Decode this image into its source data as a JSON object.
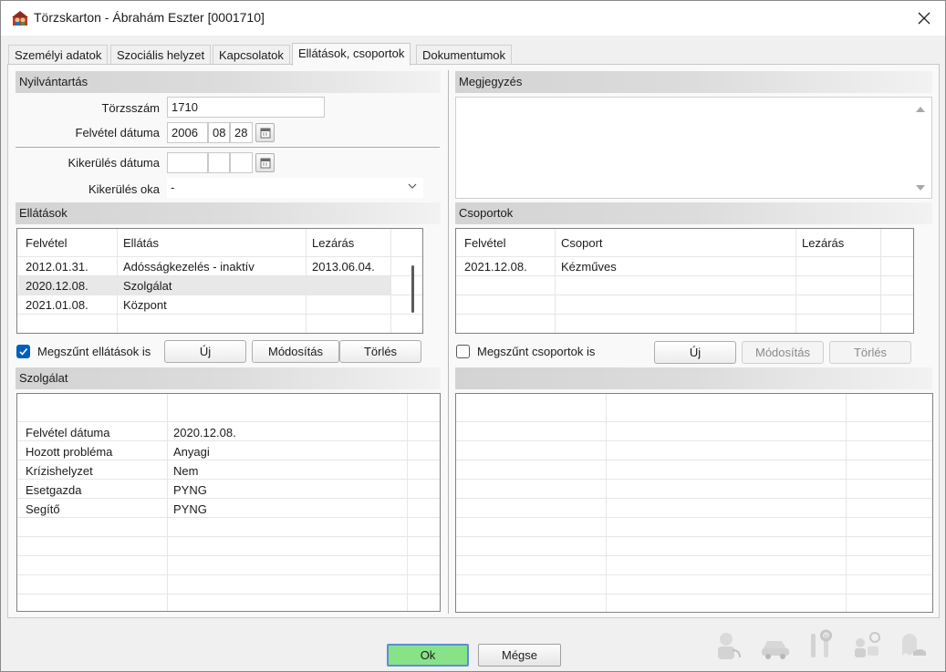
{
  "window": {
    "title": "Törzskarton - Ábrahám Eszter [0001710]"
  },
  "tabs": [
    {
      "label": "Személyi adatok"
    },
    {
      "label": "Szociális helyzet"
    },
    {
      "label": "Kapcsolatok"
    },
    {
      "label": "Ellátások, csoportok"
    },
    {
      "label": "Dokumentumok"
    }
  ],
  "nyilvantartas": {
    "header": "Nyilvántartás",
    "torzsszam_label": "Törzsszám",
    "torzsszam_value": "1710",
    "felvetel_label": "Felvétel dátuma",
    "felvetel_year": "2006",
    "felvetel_month": "08",
    "felvetel_day": "28",
    "kikerules_label": "Kikerülés dátuma",
    "kikerules_year": "",
    "kikerules_month": "",
    "kikerules_day": "",
    "kikerules_oka_label": "Kikerülés oka",
    "kikerules_oka_value": "-"
  },
  "megjegyzes": {
    "header": "Megjegyzés",
    "value": ""
  },
  "ellatasok": {
    "header": "Ellátások",
    "columns": [
      "Felvétel",
      "Ellátás",
      "Lezárás"
    ],
    "rows": [
      [
        "2012.01.31.",
        "Adósságkezelés - inaktív",
        "2013.06.04."
      ],
      [
        "2020.12.08.",
        "Szolgálat",
        ""
      ],
      [
        "2021.01.08.",
        "Központ",
        ""
      ]
    ],
    "selected_row": 1,
    "checkbox_label": "Megszűnt ellátások is",
    "checkbox_checked": true,
    "btn_new": "Új",
    "btn_edit": "Módosítás",
    "btn_delete": "Törlés"
  },
  "csoportok": {
    "header": "Csoportok",
    "columns": [
      "Felvétel",
      "Csoport",
      "Lezárás"
    ],
    "rows": [
      [
        "2021.12.08.",
        "Kézműves",
        ""
      ]
    ],
    "checkbox_label": "Megszűnt csoportok is",
    "checkbox_checked": false,
    "btn_new": "Új",
    "btn_edit": "Módosítás",
    "btn_delete": "Törlés"
  },
  "szolgalat": {
    "header": "Szolgálat",
    "rows": [
      [
        "Felvétel dátuma",
        "2020.12.08."
      ],
      [
        "Hozott probléma",
        "Anyagi"
      ],
      [
        "Krízishelyzet",
        "Nem"
      ],
      [
        "Esetgazda",
        "PYNG"
      ],
      [
        "Segítő",
        "PYNG"
      ]
    ]
  },
  "right_detail": {
    "header": ""
  },
  "footer": {
    "ok_label": "Ok",
    "cancel_label": "Mégse"
  },
  "colors": {
    "accent": "#005fb8",
    "ok_green": "#88e288"
  }
}
